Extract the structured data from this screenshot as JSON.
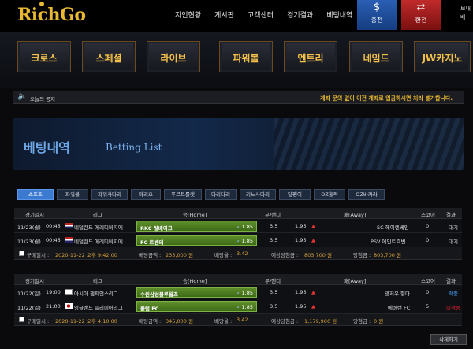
{
  "header": {
    "logo": "RichGo",
    "nav": [
      "지인현황",
      "게시판",
      "고객센터",
      "경기결과",
      "베팅내역"
    ],
    "charge": {
      "label": "충전",
      "icon": "deposit-icon"
    },
    "withdraw": {
      "label": "환전",
      "icon": "withdraw-icon"
    },
    "side_labels": [
      "보내",
      "배"
    ]
  },
  "main_nav": [
    "크로스",
    "스페셜",
    "라이브",
    "파워볼",
    "엔트리",
    "네임드",
    "JW카지노"
  ],
  "notice": {
    "label": "오늘의 공지",
    "text": "계좌 문의 없이 이전 계좌로 입금하시면 처리 불가합니다."
  },
  "banner": {
    "title_ko": "베팅내역",
    "title_en": "Betting List"
  },
  "tabs": [
    "스포츠",
    "파워볼",
    "파워사다리",
    "마리오",
    "푸르트룰렛",
    "다리다리",
    "키노사다리",
    "달팽이",
    "OZ홀짝",
    "OZ바카라"
  ],
  "columns": [
    "경기일시",
    "리그",
    "승[Home]",
    "무/핸디",
    "패[Away]",
    "스코어",
    "결과"
  ],
  "bets": [
    {
      "games": [
        {
          "date": "11/23(월)",
          "time": "00:45",
          "flag": "nl",
          "league": "네덜란드 에레디비지에",
          "home": "RKC 발베이크",
          "home_odds": "1.85",
          "draw": "3.5",
          "away_odds": "1.95",
          "away": "SC 헤이렌베인",
          "score": "0",
          "result": "대기",
          "result_style": "normal"
        },
        {
          "date": "11/23(월)",
          "time": "00:45",
          "flag": "nl",
          "league": "네덜란드 에레디비지에",
          "home": "FC 트벤테",
          "home_odds": "1.85",
          "draw": "3.5",
          "away_odds": "1.95",
          "away": "PSV 에인트호번",
          "score": "0",
          "result": "대기",
          "result_style": "normal"
        }
      ],
      "summary": {
        "purchase_label": "구매일시 :",
        "purchase_value": "2020-11-22 오후 9:42:00",
        "amount_label": "베팅금액 :",
        "amount_value": "235,000 원",
        "rate_label": "배당율 :",
        "rate_value": "3.42",
        "expected_label": "예상당첨금 :",
        "expected_value": "803,700 원",
        "won_label": "당첨금 :",
        "won_value": "803,700 원"
      }
    },
    {
      "games": [
        {
          "date": "11/22(일)",
          "time": "19:00",
          "flag": "as",
          "league": "아시아 챔피언스리그",
          "home": "수원삼성블루윙즈",
          "home_odds": "1.85",
          "draw": "3.5",
          "away_odds": "1.95",
          "away": "광저우 헝다",
          "score": "0",
          "result": "적중",
          "result_style": "blue"
        },
        {
          "date": "11/22(일)",
          "time": "21:00",
          "flag": "jp",
          "league": "잉글랜드 프리미어리그",
          "home": "풀럼 FC",
          "home_odds": "1.85",
          "draw": "3.5",
          "away_odds": "1.95",
          "away": "에버턴 FC",
          "score": "5",
          "result": "미적중",
          "result_style": "red"
        }
      ],
      "summary": {
        "purchase_label": "구매일시 :",
        "purchase_value": "2020-11-22 오후 4:10:00",
        "amount_label": "베팅금액 :",
        "amount_value": "345,000 원",
        "rate_label": "배당율 :",
        "rate_value": "3.42",
        "expected_label": "예상당첨금 :",
        "expected_value": "1,179,900 원",
        "won_label": "당첨금 :",
        "won_value": "0 원"
      }
    }
  ],
  "delete_button": "삭제하기"
}
